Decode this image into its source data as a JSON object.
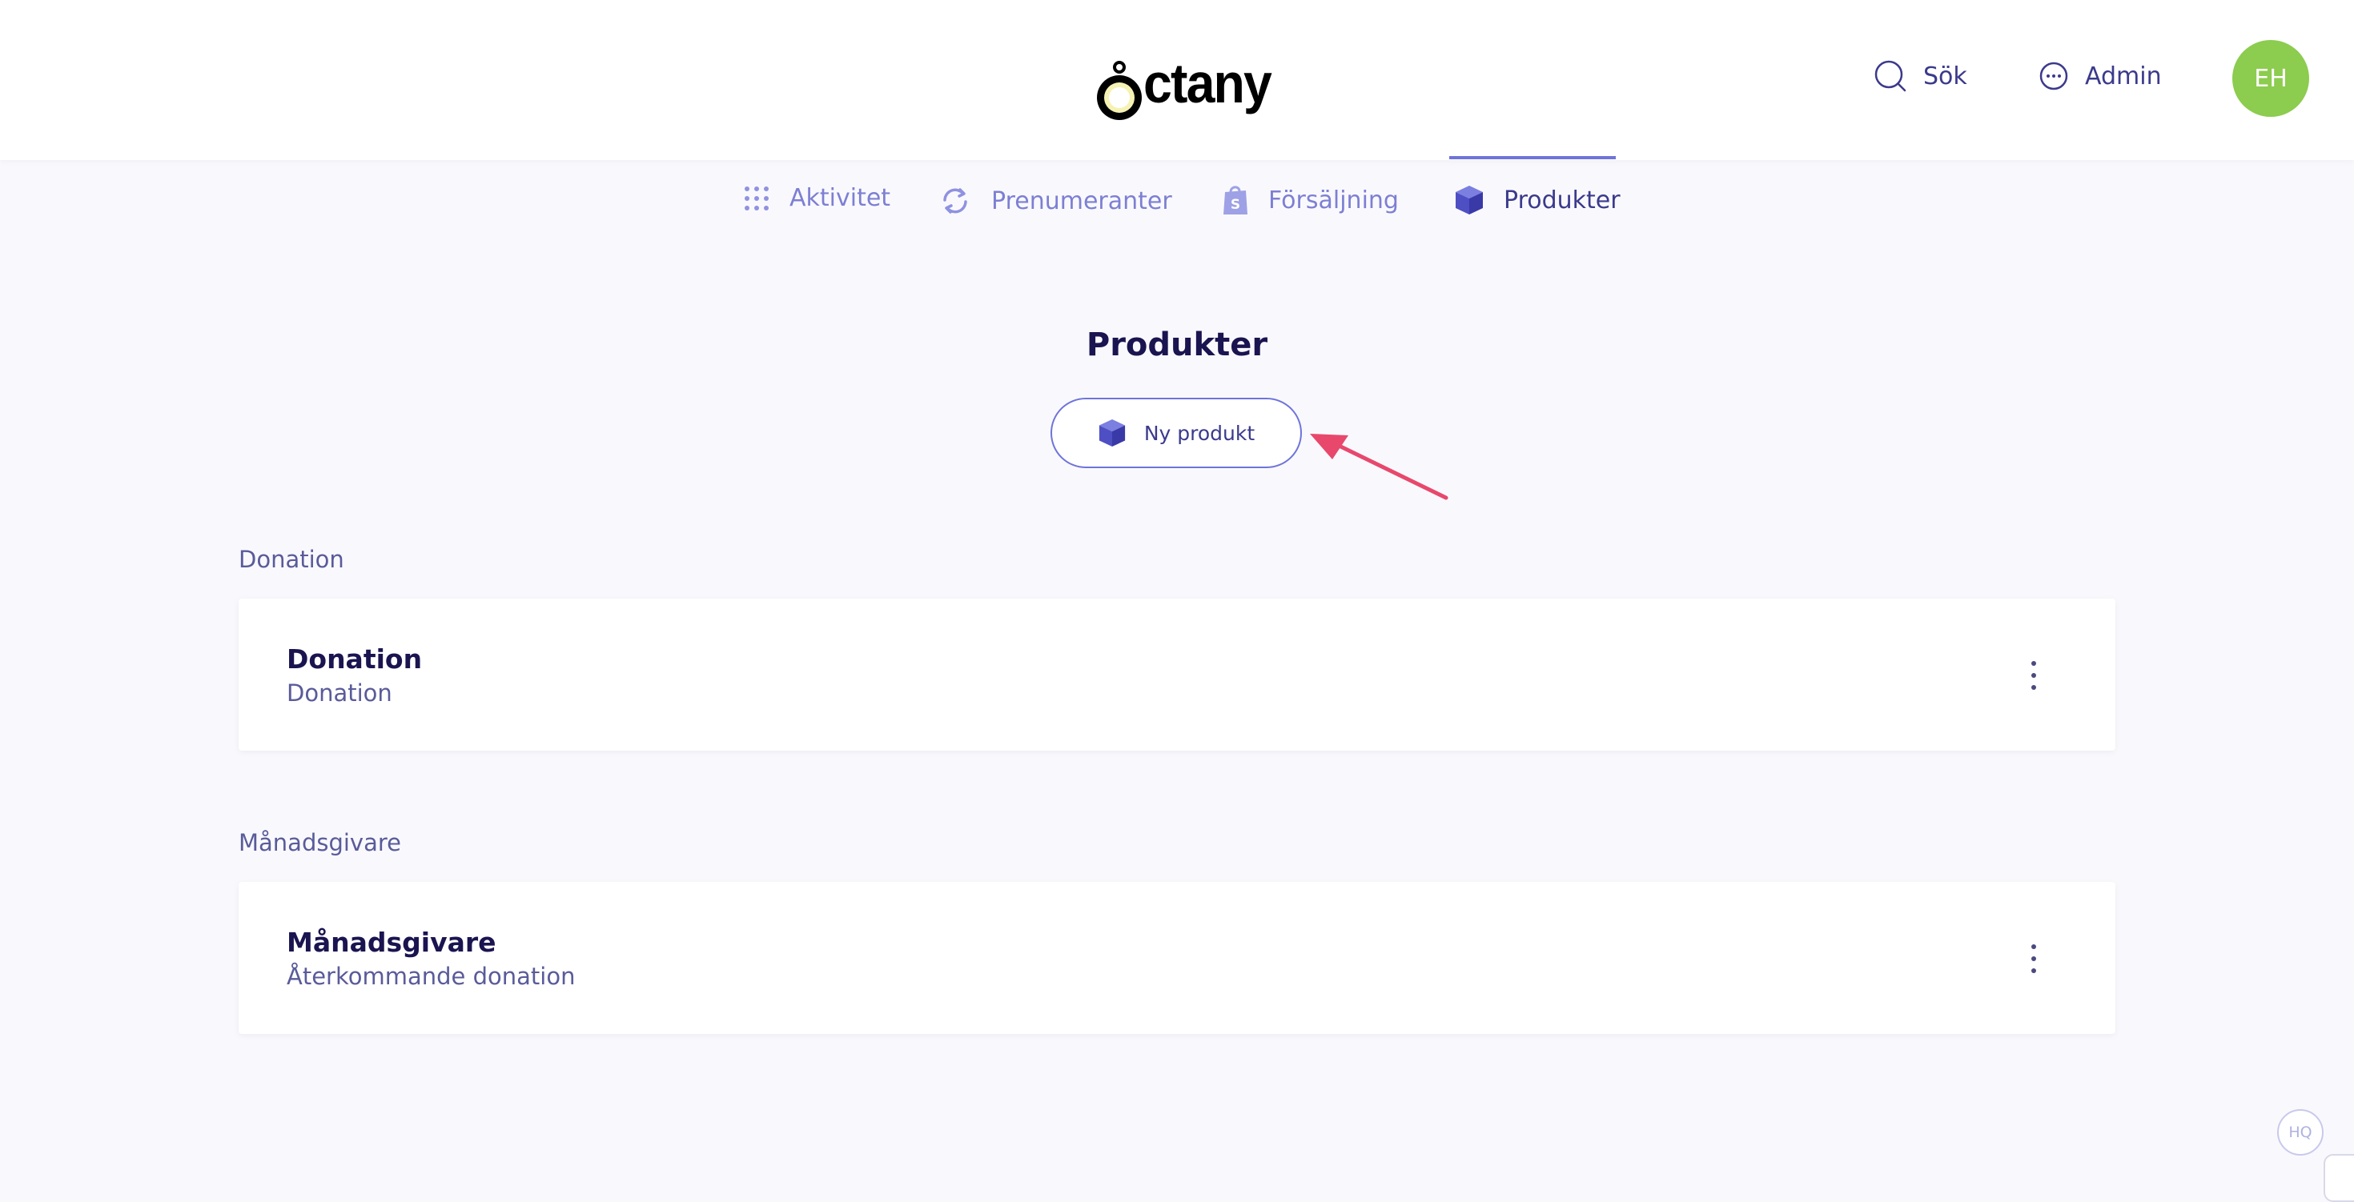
{
  "header": {
    "logo_text": "ctany",
    "search_label": "Sök",
    "admin_label": "Admin",
    "avatar_initials": "EH"
  },
  "tabs": [
    {
      "label": "Aktivitet",
      "icon": "grid-dots-icon"
    },
    {
      "label": "Prenumeranter",
      "icon": "refresh-icon"
    },
    {
      "label": "Försäljning",
      "icon": "shopify-bag-icon"
    },
    {
      "label": "Produkter",
      "icon": "cube-icon",
      "active": true
    }
  ],
  "main": {
    "title": "Produkter",
    "new_button_label": "Ny produkt",
    "sections": [
      {
        "label": "Donation",
        "card_title": "Donation",
        "card_subtitle": "Donation"
      },
      {
        "label": "Månadsgivare",
        "card_title": "Månadsgivare",
        "card_subtitle": "Återkommande donation"
      }
    ]
  },
  "support_badge": "HQ",
  "colors": {
    "accent": "#6f74d9",
    "text_dark": "#1a1450",
    "avatar_bg": "#8ccc4e",
    "annotation_arrow": "#e8486c"
  }
}
